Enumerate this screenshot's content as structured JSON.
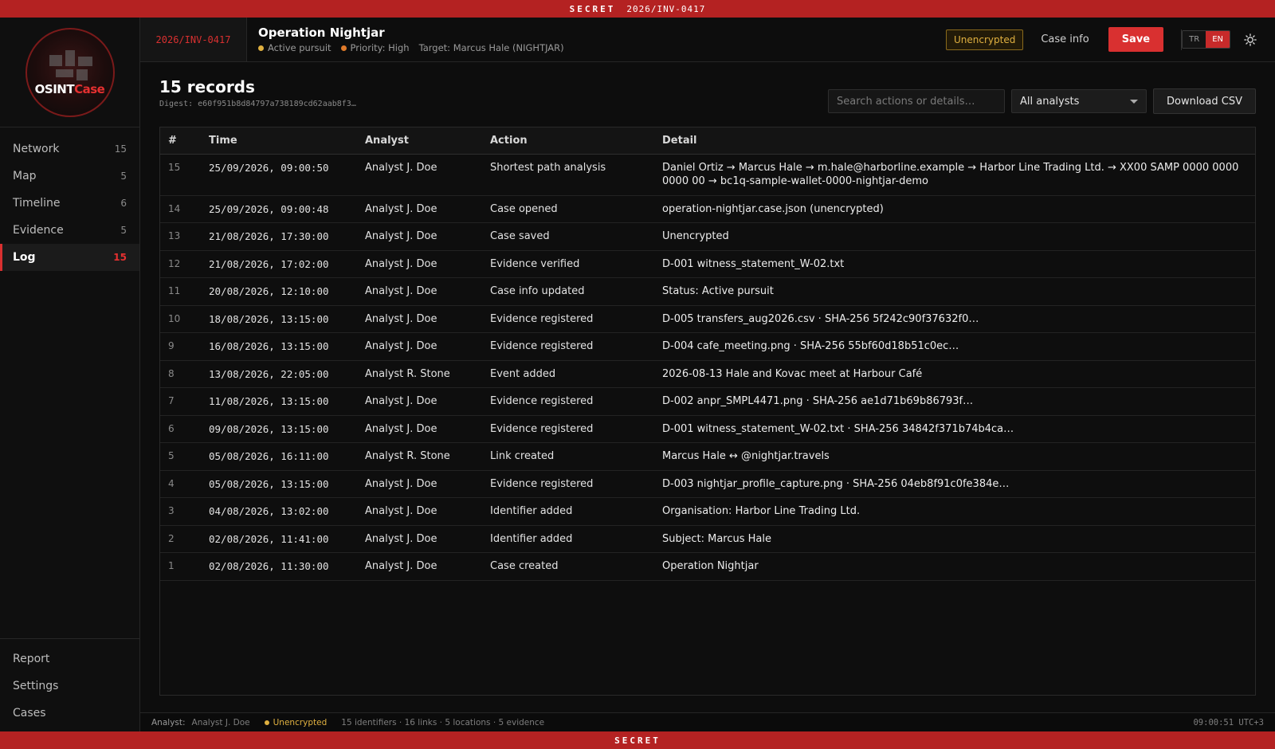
{
  "banner": {
    "top_label": "SECRET",
    "top_case": "2026/INV-0417",
    "bottom_label": "SECRET"
  },
  "logo": {
    "word_a": "OSINT",
    "word_b": "Case"
  },
  "sidebar": {
    "items": [
      {
        "label": "Network",
        "count": "15"
      },
      {
        "label": "Map",
        "count": "5"
      },
      {
        "label": "Timeline",
        "count": "6"
      },
      {
        "label": "Evidence",
        "count": "5"
      },
      {
        "label": "Log",
        "count": "15"
      }
    ],
    "bottom": [
      {
        "label": "Report"
      },
      {
        "label": "Settings"
      },
      {
        "label": "Cases"
      }
    ]
  },
  "header": {
    "case_id": "2026/INV-0417",
    "title": "Operation Nightjar",
    "status": "Active pursuit",
    "priority": "Priority: High",
    "target": "Target: Marcus Hale (NIGHTJAR)",
    "encryption_badge": "Unencrypted",
    "case_info_label": "Case info",
    "save_label": "Save",
    "lang_tr": "TR",
    "lang_en": "EN"
  },
  "colors": {
    "accent": "#d93030",
    "status_active": "#e0b040",
    "priority_high": "#e07a2a",
    "warning": "#e0b040"
  },
  "log": {
    "records_title": "15 records",
    "digest": "Digest: e60f951b8d84797a738189cd62aab8f3…",
    "search_placeholder": "Search actions or details…",
    "analyst_filter": "All analysts",
    "download_label": "Download CSV",
    "columns": {
      "idx": "#",
      "time": "Time",
      "analyst": "Analyst",
      "action": "Action",
      "detail": "Detail"
    },
    "rows": [
      {
        "idx": "15",
        "time": "25/09/2026, 09:00:50",
        "analyst": "Analyst J. Doe",
        "action": "Shortest path analysis",
        "detail": "Daniel Ortiz → Marcus Hale → m.hale@harborline.example → Harbor Line Trading Ltd. → XX00 SAMP 0000 0000 0000 00 → bc1q-sample-wallet-0000-nightjar-demo"
      },
      {
        "idx": "14",
        "time": "25/09/2026, 09:00:48",
        "analyst": "Analyst J. Doe",
        "action": "Case opened",
        "detail": "operation-nightjar.case.json (unencrypted)"
      },
      {
        "idx": "13",
        "time": "21/08/2026, 17:30:00",
        "analyst": "Analyst J. Doe",
        "action": "Case saved",
        "detail": "Unencrypted"
      },
      {
        "idx": "12",
        "time": "21/08/2026, 17:02:00",
        "analyst": "Analyst J. Doe",
        "action": "Evidence verified",
        "detail": "D-001 witness_statement_W-02.txt"
      },
      {
        "idx": "11",
        "time": "20/08/2026, 12:10:00",
        "analyst": "Analyst J. Doe",
        "action": "Case info updated",
        "detail": "Status: Active pursuit"
      },
      {
        "idx": "10",
        "time": "18/08/2026, 13:15:00",
        "analyst": "Analyst J. Doe",
        "action": "Evidence registered",
        "detail": "D-005 transfers_aug2026.csv · SHA-256 5f242c90f37632f0…"
      },
      {
        "idx": "9",
        "time": "16/08/2026, 13:15:00",
        "analyst": "Analyst J. Doe",
        "action": "Evidence registered",
        "detail": "D-004 cafe_meeting.png · SHA-256 55bf60d18b51c0ec…"
      },
      {
        "idx": "8",
        "time": "13/08/2026, 22:05:00",
        "analyst": "Analyst R. Stone",
        "action": "Event added",
        "detail": "2026-08-13 Hale and Kovac meet at Harbour Café"
      },
      {
        "idx": "7",
        "time": "11/08/2026, 13:15:00",
        "analyst": "Analyst J. Doe",
        "action": "Evidence registered",
        "detail": "D-002 anpr_SMPL4471.png · SHA-256 ae1d71b69b86793f…"
      },
      {
        "idx": "6",
        "time": "09/08/2026, 13:15:00",
        "analyst": "Analyst J. Doe",
        "action": "Evidence registered",
        "detail": "D-001 witness_statement_W-02.txt · SHA-256 34842f371b74b4ca…"
      },
      {
        "idx": "5",
        "time": "05/08/2026, 16:11:00",
        "analyst": "Analyst R. Stone",
        "action": "Link created",
        "detail": "Marcus Hale ↔ @nightjar.travels"
      },
      {
        "idx": "4",
        "time": "05/08/2026, 13:15:00",
        "analyst": "Analyst J. Doe",
        "action": "Evidence registered",
        "detail": "D-003 nightjar_profile_capture.png · SHA-256 04eb8f91c0fe384e…"
      },
      {
        "idx": "3",
        "time": "04/08/2026, 13:02:00",
        "analyst": "Analyst J. Doe",
        "action": "Identifier added",
        "detail": "Organisation: Harbor Line Trading Ltd."
      },
      {
        "idx": "2",
        "time": "02/08/2026, 11:41:00",
        "analyst": "Analyst J. Doe",
        "action": "Identifier added",
        "detail": "Subject: Marcus Hale"
      },
      {
        "idx": "1",
        "time": "02/08/2026, 11:30:00",
        "analyst": "Analyst J. Doe",
        "action": "Case created",
        "detail": "Operation Nightjar"
      }
    ]
  },
  "statusbar": {
    "analyst_label": "Analyst:",
    "analyst_value": "Analyst J. Doe",
    "encryption": "Unencrypted",
    "summary": "15 identifiers · 16 links · 5 locations · 5 evidence",
    "clock": "09:00:51 UTC+3"
  }
}
